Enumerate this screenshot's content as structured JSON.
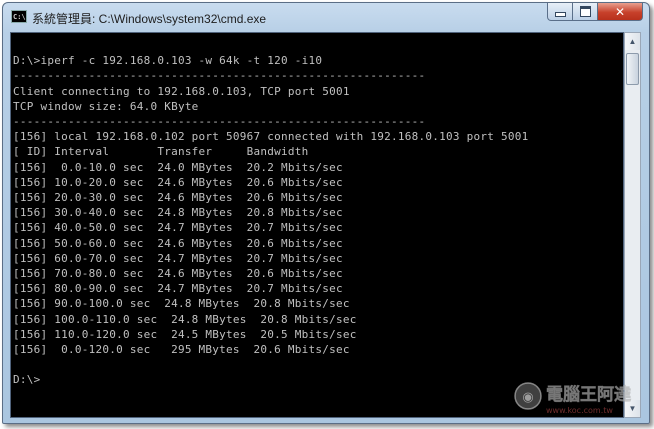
{
  "window": {
    "title": "系統管理員: C:\\Windows\\system32\\cmd.exe",
    "icon": "cmd-icon",
    "icon_text": "C:\\",
    "close_glyph": "✕"
  },
  "console": {
    "lines": [
      "",
      "D:\\>iperf -c 192.168.0.103 -w 64k -t 120 -i10",
      "------------------------------------------------------------",
      "Client connecting to 192.168.0.103, TCP port 5001",
      "TCP window size: 64.0 KByte",
      "------------------------------------------------------------",
      "[156] local 192.168.0.102 port 50967 connected with 192.168.0.103 port 5001",
      "[ ID] Interval       Transfer     Bandwidth",
      "[156]  0.0-10.0 sec  24.0 MBytes  20.2 Mbits/sec",
      "[156] 10.0-20.0 sec  24.6 MBytes  20.6 Mbits/sec",
      "[156] 20.0-30.0 sec  24.6 MBytes  20.6 Mbits/sec",
      "[156] 30.0-40.0 sec  24.8 MBytes  20.8 Mbits/sec",
      "[156] 40.0-50.0 sec  24.7 MBytes  20.7 Mbits/sec",
      "[156] 50.0-60.0 sec  24.6 MBytes  20.6 Mbits/sec",
      "[156] 60.0-70.0 sec  24.7 MBytes  20.7 Mbits/sec",
      "[156] 70.0-80.0 sec  24.6 MBytes  20.6 Mbits/sec",
      "[156] 80.0-90.0 sec  24.7 MBytes  20.7 Mbits/sec",
      "[156] 90.0-100.0 sec  24.8 MBytes  20.8 Mbits/sec",
      "[156] 100.0-110.0 sec  24.8 MBytes  20.8 Mbits/sec",
      "[156] 110.0-120.0 sec  24.5 MBytes  20.5 Mbits/sec",
      "[156]  0.0-120.0 sec   295 MBytes  20.6 Mbits/sec",
      "",
      "D:\\>"
    ]
  },
  "colors": {
    "console_bg": "#000000",
    "console_text": "#c0c0c0",
    "close_button": "#c7412b"
  },
  "watermark": {
    "text": "電腦王阿達",
    "url": "www.koc.com.tw"
  }
}
